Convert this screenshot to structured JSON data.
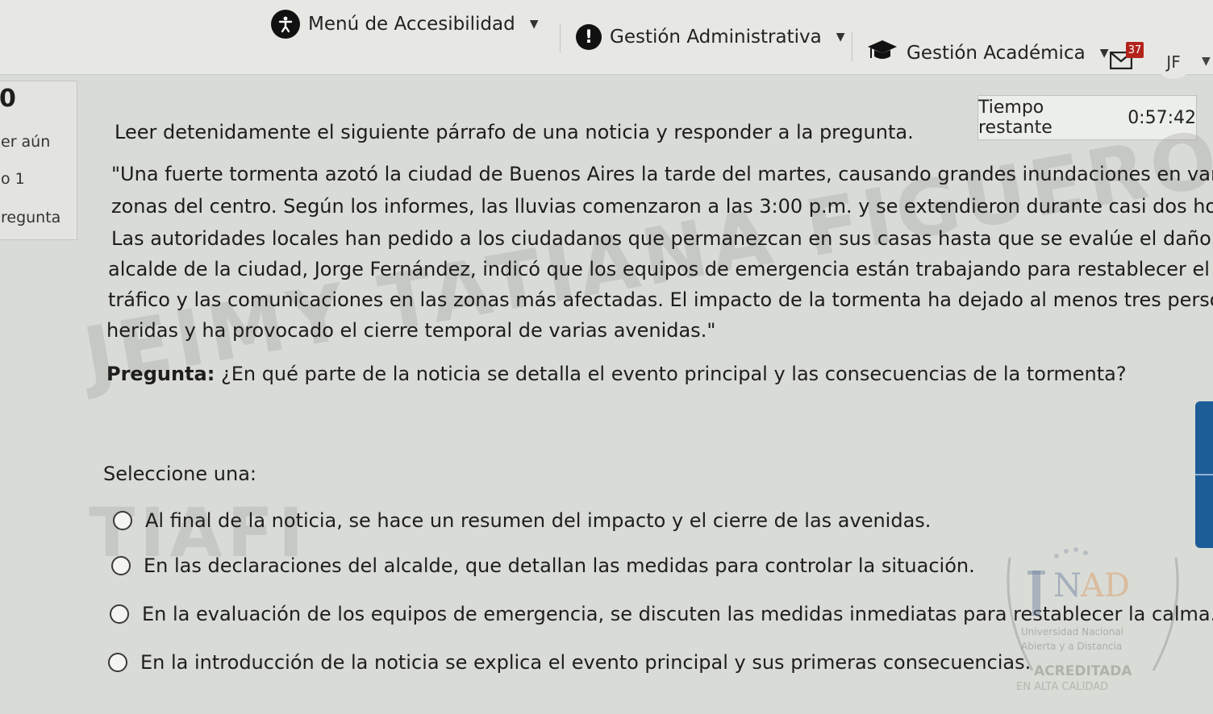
{
  "nav": {
    "accessibility": {
      "label": "Menú de Accesibilidad",
      "icon": "accessibility-icon"
    },
    "admin": {
      "label": "Gestión Administrativa",
      "icon": "alert-icon"
    },
    "academic": {
      "label": "Gestión Académica",
      "icon": "graduation-cap-icon"
    },
    "messages": {
      "count": "37",
      "icon": "mail-icon"
    },
    "user": {
      "initials": "JF"
    }
  },
  "question_nav": {
    "number": "0",
    "status": "er aún",
    "points": "o 1",
    "flag": "regunta"
  },
  "timer": {
    "label": "Tiempo restante",
    "value": "0:57:42"
  },
  "question": {
    "instruction": "Leer detenidamente el siguiente párrafo de una noticia y responder a la pregunta.",
    "passage_lines": [
      "\"Una fuerte tormenta azotó la ciudad de Buenos Aires la tarde del martes, causando grandes inundaciones en varias",
      "zonas del centro. Según los informes, las lluvias comenzaron a las 3:00 p.m. y se extendieron durante casi dos horas.",
      "Las autoridades locales han pedido a los ciudadanos que permanezcan en sus casas hasta que se evalúe el daño. El",
      "alcalde de la ciudad, Jorge Fernández, indicó que los equipos de emergencia están trabajando para restablecer el",
      "tráfico y las comunicaciones en las zonas más afectadas. El impacto de la tormenta ha dejado al menos tres personas",
      "heridas y ha provocado el cierre temporal de varias avenidas.\""
    ],
    "prompt_label": "Pregunta:",
    "prompt_text": " ¿En qué parte de la noticia se detalla el evento principal y las consecuencias de la tormenta?",
    "select_label": "Seleccione una:",
    "options": [
      "Al final de la noticia, se hace un resumen del impacto y el cierre de las avenidas.",
      "En las declaraciones del alcalde, que detallan las medidas para controlar la situación.",
      "En la evaluación de los equipos de emergencia, se discuten las medidas inmediatas para restablecer la calma.",
      "En la introducción de la noticia se explica el evento principal y sus primeras consecuencias."
    ]
  },
  "watermark": {
    "line1": "JEIMY TATIANA FIGUEROA",
    "line2": "TIAFI"
  },
  "logo": {
    "name": "UNAD",
    "line1": "Universidad Nacional",
    "line2": "Abierta y a Distancia",
    "badge": "ACREDITADA",
    "badge_sub": "EN ALTA CALIDAD"
  }
}
